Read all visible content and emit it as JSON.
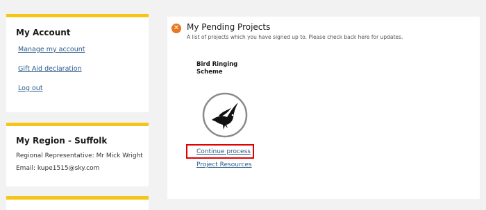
{
  "account": {
    "title": "My Account",
    "links": [
      "Manage my account",
      "Gift Aid declaration",
      "Log out"
    ]
  },
  "region": {
    "title": "My Region - Suffolk",
    "representative": "Regional Representative: Mr Mick Wright",
    "email": "Email: kupe1515@sky.com"
  },
  "pending": {
    "title": "My Pending Projects",
    "subtitle": "A list of projects which you have signed up to. Please check back here for updates.",
    "close_icon": "close-icon",
    "project": {
      "name_line1": "Bird Ringing",
      "name_line2": "Scheme",
      "logo_icon": "bird-logo-icon",
      "continue_label": "Continue process",
      "resources_label": "Project Resources"
    }
  },
  "colors": {
    "accent_yellow": "#f5c518",
    "close_orange": "#e87722",
    "link_blue": "#2a5c8a",
    "highlight_red": "#e00000"
  }
}
